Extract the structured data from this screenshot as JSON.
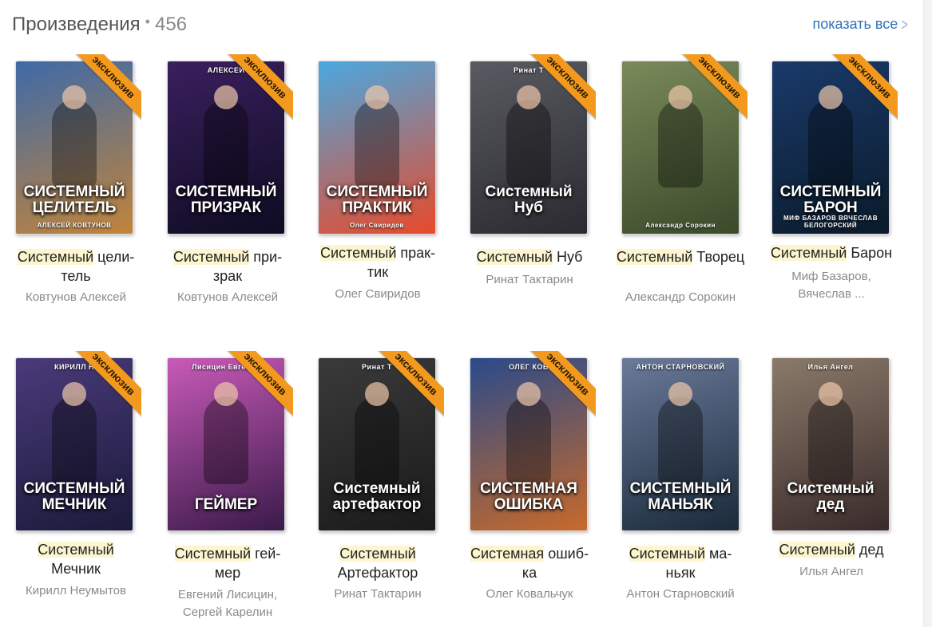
{
  "header": {
    "title": "Произведения",
    "count": "456",
    "show_all": "показать все"
  },
  "books": [
    {
      "title_hl": "Системный",
      "title_rest": " цели-тель",
      "authors": "Ковтунов Алексей",
      "exclusive": "эксклюзив",
      "cover_author": "",
      "cover_title": "СИСТЕМНЫЙ ЦЕЛИТЕЛЬ",
      "cover_bottom": "АЛЕКСЕЙ КОВТУНОВ",
      "colors": [
        "#3e6aa8",
        "#c2843a"
      ]
    },
    {
      "title_hl": "Системный",
      "title_rest": " при-зрак",
      "authors": "Ковтунов Алексей",
      "exclusive": "эксклюзив",
      "cover_author": "АЛЕКСЕЙ",
      "cover_title": "СИСТЕМНЫЙ ПРИЗРАК",
      "cover_bottom": "",
      "colors": [
        "#3a1f5e",
        "#0e0c22"
      ]
    },
    {
      "title_hl": "Системный",
      "title_rest": " прак-тик",
      "authors": "Олег Свиридов",
      "exclusive": "",
      "cover_author": "",
      "cover_title": "СИСТЕМНЫЙ ПРАКТИК",
      "cover_bottom": "Олег Свиридов",
      "colors": [
        "#4aa8e0",
        "#e84a2a"
      ]
    },
    {
      "title_hl": "Системный",
      "title_rest": " Нуб",
      "authors": "Ринат Тактарин",
      "exclusive": "эксклюзив",
      "cover_author": "Ринат Т",
      "cover_title": "Системный Нуб",
      "cover_bottom": "",
      "colors": [
        "#5a5a62",
        "#2a2a30"
      ]
    },
    {
      "title_hl": "Системный",
      "title_rest": " Творец",
      "authors": "Александр Сорокин",
      "exclusive": "эксклюзив",
      "cover_author": "",
      "cover_title": "",
      "cover_bottom": "Александр Сорокин",
      "colors": [
        "#7a8a5a",
        "#3a4a2a"
      ]
    },
    {
      "title_hl": "Системный",
      "title_rest": " Барон",
      "authors": "Миф Базаров, Вячеслав ...",
      "exclusive": "эксклюзив",
      "cover_author": "",
      "cover_title": "СИСТЕМНЫЙ БАРОН",
      "cover_bottom": "МИФ БАЗАРОВ   ВЯЧЕСЛАВ БЕЛОГОРСКИЙ",
      "colors": [
        "#1a3a6a",
        "#0a1a2a"
      ]
    },
    {
      "title_hl": "Системный",
      "title_rest": " Мечник",
      "authors": "Кирилл Неумытов",
      "exclusive": "эксклюзив",
      "cover_author": "КИРИЛЛ Н",
      "cover_title": "СИСТЕМНЫЙ МЕЧНИК",
      "cover_bottom": "",
      "colors": [
        "#4a3a7a",
        "#1a1a3a"
      ]
    },
    {
      "title_hl": "Системный",
      "title_rest": " гей-мер",
      "authors": "Евгений Лисицин, Сергей Карелин",
      "exclusive": "эксклюзив",
      "cover_author": "Лисицин Евгений",
      "cover_title": "ГЕЙМЕР",
      "cover_bottom": "",
      "colors": [
        "#c85ab8",
        "#3a1a4a"
      ]
    },
    {
      "title_hl": "Системный",
      "title_rest": " Артефактор",
      "authors": "Ринат Тактарин",
      "exclusive": "эксклюзив",
      "cover_author": "Ринат Т",
      "cover_title": "Системный артефактор",
      "cover_bottom": "",
      "colors": [
        "#3a3a3a",
        "#1a1a1a"
      ]
    },
    {
      "title_hl": "Системная",
      "title_rest": " ошиб-ка",
      "authors": "Олег Ковальчук",
      "exclusive": "эксклюзив",
      "cover_author": "ОЛЕГ КОВ",
      "cover_title": "СИСТЕМНАЯ ОШИБКА",
      "cover_bottom": "",
      "colors": [
        "#2a4a8a",
        "#c86a2a"
      ]
    },
    {
      "title_hl": "Системный",
      "title_rest": " ма-ньяк",
      "authors": "Антон Старновский",
      "exclusive": "",
      "cover_author": "АНТОН СТАРНОВСКИЙ",
      "cover_title": "СИСТЕМНЫЙ МАНЬЯК",
      "cover_bottom": "",
      "colors": [
        "#6a7a9a",
        "#1a2a3a"
      ]
    },
    {
      "title_hl": "Системный",
      "title_rest": " дед",
      "authors": "Илья Ангел",
      "exclusive": "",
      "cover_author": "Илья Ангел",
      "cover_title": "Системный дед",
      "cover_bottom": "",
      "colors": [
        "#8a7a6a",
        "#3a2a2a"
      ]
    }
  ]
}
